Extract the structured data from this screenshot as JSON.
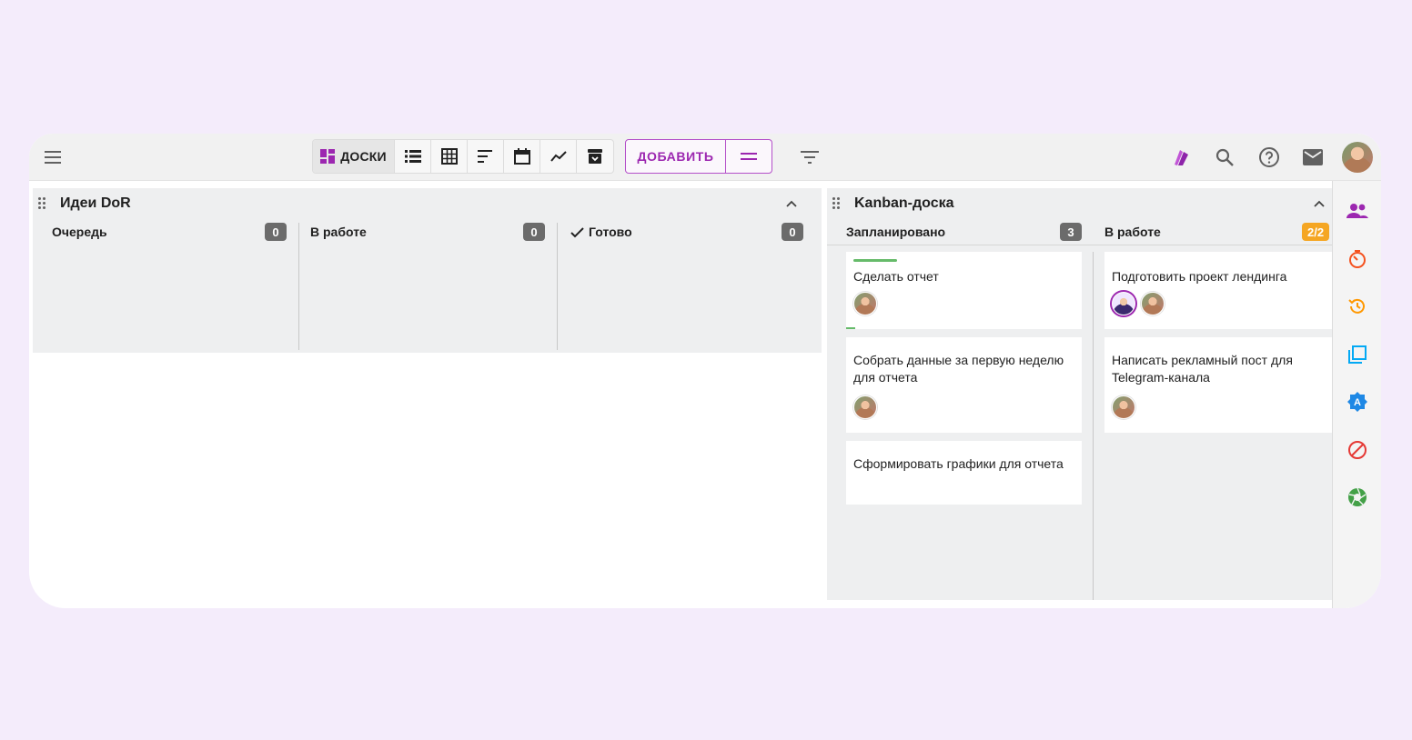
{
  "toolbar": {
    "views": [
      {
        "name": "view-boards",
        "label": "ДОСКИ",
        "icon": "boards-icon"
      },
      {
        "name": "view-list",
        "icon": "list-icon"
      },
      {
        "name": "view-table",
        "icon": "grid-icon"
      },
      {
        "name": "view-gantt",
        "icon": "gantt-icon"
      },
      {
        "name": "view-calendar",
        "icon": "calendar-icon"
      },
      {
        "name": "view-chart",
        "icon": "trend-icon"
      },
      {
        "name": "view-archive",
        "icon": "archive-icon"
      }
    ],
    "add_label": "ДОБАВИТЬ",
    "accent": "#9c27b0"
  },
  "boards": [
    {
      "title": "Идеи DoR",
      "columns": [
        {
          "title": "Очередь",
          "count": "0"
        },
        {
          "title": "В работе",
          "count": "0"
        },
        {
          "title": "Готово",
          "count": "0",
          "done": true
        }
      ]
    },
    {
      "title": "Kanban-доска",
      "columns": [
        {
          "title": "Запланировано",
          "count": "3",
          "cards": [
            {
              "text": "Сделать отчет"
            },
            {
              "text": "Собрать данные за первую неделю для отчета"
            },
            {
              "text": "Сформировать графики для отчета"
            }
          ]
        },
        {
          "title": "В работе",
          "count": "2/2",
          "count_color": "#f5a623",
          "cards": [
            {
              "text": "Подготовить проект лендинга"
            },
            {
              "text": "Написать рекламный пост для Telegram-канала"
            }
          ]
        }
      ]
    }
  ],
  "sidebar_icons": [
    "people-icon",
    "timer-icon",
    "history-icon",
    "copy-icon",
    "badge-a-icon",
    "block-icon",
    "aperture-icon"
  ]
}
